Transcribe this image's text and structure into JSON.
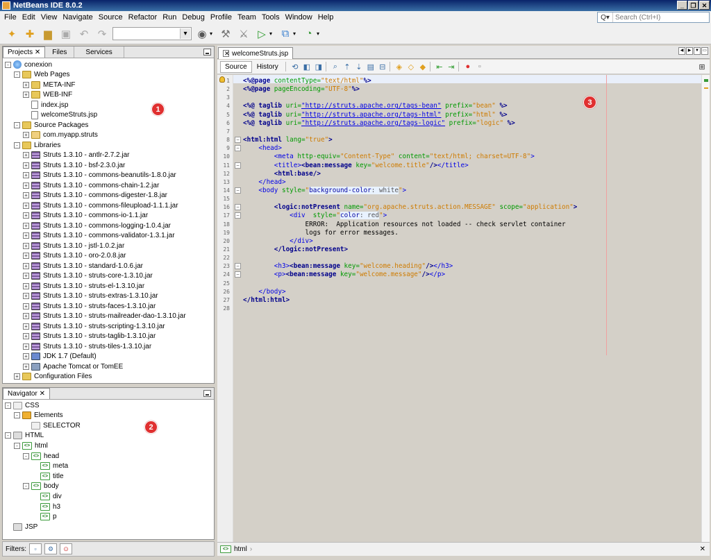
{
  "window": {
    "title": "NetBeans IDE 8.0.2",
    "buttons": [
      "_",
      "❐",
      "✕"
    ]
  },
  "menu": [
    "File",
    "Edit",
    "View",
    "Navigate",
    "Source",
    "Refactor",
    "Run",
    "Debug",
    "Profile",
    "Team",
    "Tools",
    "Window",
    "Help"
  ],
  "search": {
    "placeholder": "Search (Ctrl+I)"
  },
  "projects": {
    "tabs": [
      "Projects ✕",
      "Files",
      "Services"
    ],
    "nodes": [
      {
        "label": "conexion",
        "icon": "globe",
        "depth": 0,
        "exp": "-"
      },
      {
        "label": "Web Pages",
        "icon": "folder",
        "depth": 1,
        "exp": "-"
      },
      {
        "label": "META-INF",
        "icon": "folder",
        "depth": 2,
        "exp": "+"
      },
      {
        "label": "WEB-INF",
        "icon": "folder",
        "depth": 2,
        "exp": "+"
      },
      {
        "label": "index.jsp",
        "icon": "file",
        "depth": 2,
        "exp": ""
      },
      {
        "label": "welcomeStruts.jsp",
        "icon": "file",
        "depth": 2,
        "exp": ""
      },
      {
        "label": "Source Packages",
        "icon": "folder",
        "depth": 1,
        "exp": "-"
      },
      {
        "label": "com.myapp.struts",
        "icon": "pkg",
        "depth": 2,
        "exp": "+"
      },
      {
        "label": "Libraries",
        "icon": "folder",
        "depth": 1,
        "exp": "-"
      },
      {
        "label": "Struts 1.3.10 - antlr-2.7.2.jar",
        "icon": "jar",
        "depth": 2,
        "exp": "+"
      },
      {
        "label": "Struts 1.3.10 - bsf-2.3.0.jar",
        "icon": "jar",
        "depth": 2,
        "exp": "+"
      },
      {
        "label": "Struts 1.3.10 - commons-beanutils-1.8.0.jar",
        "icon": "jar",
        "depth": 2,
        "exp": "+"
      },
      {
        "label": "Struts 1.3.10 - commons-chain-1.2.jar",
        "icon": "jar",
        "depth": 2,
        "exp": "+"
      },
      {
        "label": "Struts 1.3.10 - commons-digester-1.8.jar",
        "icon": "jar",
        "depth": 2,
        "exp": "+"
      },
      {
        "label": "Struts 1.3.10 - commons-fileupload-1.1.1.jar",
        "icon": "jar",
        "depth": 2,
        "exp": "+"
      },
      {
        "label": "Struts 1.3.10 - commons-io-1.1.jar",
        "icon": "jar",
        "depth": 2,
        "exp": "+"
      },
      {
        "label": "Struts 1.3.10 - commons-logging-1.0.4.jar",
        "icon": "jar",
        "depth": 2,
        "exp": "+"
      },
      {
        "label": "Struts 1.3.10 - commons-validator-1.3.1.jar",
        "icon": "jar",
        "depth": 2,
        "exp": "+"
      },
      {
        "label": "Struts 1.3.10 - jstl-1.0.2.jar",
        "icon": "jar",
        "depth": 2,
        "exp": "+"
      },
      {
        "label": "Struts 1.3.10 - oro-2.0.8.jar",
        "icon": "jar",
        "depth": 2,
        "exp": "+"
      },
      {
        "label": "Struts 1.3.10 - standard-1.0.6.jar",
        "icon": "jar",
        "depth": 2,
        "exp": "+"
      },
      {
        "label": "Struts 1.3.10 - struts-core-1.3.10.jar",
        "icon": "jar",
        "depth": 2,
        "exp": "+"
      },
      {
        "label": "Struts 1.3.10 - struts-el-1.3.10.jar",
        "icon": "jar",
        "depth": 2,
        "exp": "+"
      },
      {
        "label": "Struts 1.3.10 - struts-extras-1.3.10.jar",
        "icon": "jar",
        "depth": 2,
        "exp": "+"
      },
      {
        "label": "Struts 1.3.10 - struts-faces-1.3.10.jar",
        "icon": "jar",
        "depth": 2,
        "exp": "+"
      },
      {
        "label": "Struts 1.3.10 - struts-mailreader-dao-1.3.10.jar",
        "icon": "jar",
        "depth": 2,
        "exp": "+"
      },
      {
        "label": "Struts 1.3.10 - struts-scripting-1.3.10.jar",
        "icon": "jar",
        "depth": 2,
        "exp": "+"
      },
      {
        "label": "Struts 1.3.10 - struts-taglib-1.3.10.jar",
        "icon": "jar",
        "depth": 2,
        "exp": "+"
      },
      {
        "label": "Struts 1.3.10 - struts-tiles-1.3.10.jar",
        "icon": "jar",
        "depth": 2,
        "exp": "+"
      },
      {
        "label": "JDK 1.7 (Default)",
        "icon": "jdk",
        "depth": 2,
        "exp": "+"
      },
      {
        "label": "Apache Tomcat or TomEE",
        "icon": "server",
        "depth": 2,
        "exp": "+"
      },
      {
        "label": "Configuration Files",
        "icon": "folder",
        "depth": 1,
        "exp": "+"
      }
    ]
  },
  "navigator": {
    "tab": "Navigator ✕",
    "nodes": [
      {
        "label": "CSS",
        "icon": "css",
        "depth": 0,
        "exp": "-"
      },
      {
        "label": "Elements",
        "icon": "elem",
        "depth": 1,
        "exp": "-"
      },
      {
        "label": "SELECTOR",
        "icon": "css",
        "depth": 2,
        "exp": ""
      },
      {
        "label": "HTML",
        "icon": "html",
        "depth": 0,
        "exp": "-"
      },
      {
        "label": "html",
        "icon": "tag",
        "depth": 1,
        "exp": "-"
      },
      {
        "label": "head",
        "icon": "tag",
        "depth": 2,
        "exp": "-"
      },
      {
        "label": "meta",
        "icon": "tag",
        "depth": 3,
        "exp": ""
      },
      {
        "label": "title",
        "icon": "tag",
        "depth": 3,
        "exp": ""
      },
      {
        "label": "body",
        "icon": "tag",
        "depth": 2,
        "exp": "-"
      },
      {
        "label": "div",
        "icon": "tag",
        "depth": 3,
        "exp": ""
      },
      {
        "label": "h3",
        "icon": "tag",
        "depth": 3,
        "exp": ""
      },
      {
        "label": "p",
        "icon": "tag",
        "depth": 3,
        "exp": ""
      },
      {
        "label": "JSP",
        "icon": "html",
        "depth": 0,
        "exp": ""
      }
    ],
    "filters_label": "Filters:"
  },
  "editor": {
    "tab": "welcomeStruts.jsp",
    "source_tab": "Source",
    "history_tab": "History",
    "lines": [
      [
        [
          "k",
          "<%@page "
        ],
        [
          "a",
          "contentType="
        ],
        [
          "s",
          "\"text/html\""
        ],
        [
          "k",
          "%>"
        ]
      ],
      [
        [
          "k",
          "<%@page "
        ],
        [
          "a",
          "pageEncoding="
        ],
        [
          "s",
          "\"UTF-8\""
        ],
        [
          "k",
          "%>"
        ]
      ],
      [],
      [
        [
          "k",
          "<%@ taglib "
        ],
        [
          "a",
          "uri="
        ],
        [
          "u",
          "\"http://struts.apache.org/tags-bean\""
        ],
        [
          "a",
          " prefix="
        ],
        [
          "s",
          "\"bean\""
        ],
        [
          "k",
          " %>"
        ]
      ],
      [
        [
          "k",
          "<%@ taglib "
        ],
        [
          "a",
          "uri="
        ],
        [
          "u",
          "\"http://struts.apache.org/tags-html\""
        ],
        [
          "a",
          " prefix="
        ],
        [
          "s",
          "\"html\""
        ],
        [
          "k",
          " %>"
        ]
      ],
      [
        [
          "k",
          "<%@ taglib "
        ],
        [
          "a",
          "uri="
        ],
        [
          "u",
          "\"http://struts.apache.org/tags-logic\""
        ],
        [
          "a",
          " prefix="
        ],
        [
          "s",
          "\"logic\""
        ],
        [
          "k",
          " %>"
        ]
      ],
      [],
      [
        [
          "k",
          "<html:html "
        ],
        [
          "a",
          "lang="
        ],
        [
          "s",
          "\"true\""
        ],
        [
          "k",
          ">"
        ]
      ],
      [
        [
          "b",
          "    "
        ],
        [
          "t",
          "<head>"
        ]
      ],
      [
        [
          "b",
          "        "
        ],
        [
          "t",
          "<meta "
        ],
        [
          "a",
          "http-equiv="
        ],
        [
          "s",
          "\"Content-Type\""
        ],
        [
          "a",
          " content="
        ],
        [
          "s",
          "\"text/html; charset=UTF-8\""
        ],
        [
          "t",
          ">"
        ]
      ],
      [
        [
          "b",
          "        "
        ],
        [
          "t",
          "<title>"
        ],
        [
          "k",
          "<bean:message "
        ],
        [
          "a",
          "key="
        ],
        [
          "s",
          "\"welcome.title\""
        ],
        [
          "k",
          "/>"
        ],
        [
          "t",
          "</title>"
        ]
      ],
      [
        [
          "b",
          "        "
        ],
        [
          "k",
          "<html:base/>"
        ]
      ],
      [
        [
          "b",
          "    "
        ],
        [
          "t",
          "</head>"
        ]
      ],
      [
        [
          "b",
          "    "
        ],
        [
          "t",
          "<body "
        ],
        [
          "a",
          "style="
        ],
        [
          "s",
          "\""
        ],
        [
          "cs",
          "background-color"
        ],
        [
          "cv",
          ": white"
        ],
        [
          "s",
          "\""
        ],
        [
          "t",
          ">"
        ]
      ],
      [],
      [
        [
          "b",
          "        "
        ],
        [
          "k",
          "<logic:notPresent "
        ],
        [
          "a",
          "name="
        ],
        [
          "s",
          "\"org.apache.struts.action.MESSAGE\""
        ],
        [
          "a",
          " scope="
        ],
        [
          "s",
          "\"application\""
        ],
        [
          "k",
          ">"
        ]
      ],
      [
        [
          "b",
          "            "
        ],
        [
          "t",
          "<div  "
        ],
        [
          "a",
          "style="
        ],
        [
          "s",
          "\""
        ],
        [
          "cs",
          "color"
        ],
        [
          "cv",
          ": red"
        ],
        [
          "s",
          "\""
        ],
        [
          "t",
          ">"
        ]
      ],
      [
        [
          "b",
          "                ERROR:  Application resources not loaded -- check servlet container"
        ]
      ],
      [
        [
          "b",
          "                logs for error messages."
        ]
      ],
      [
        [
          "b",
          "            "
        ],
        [
          "t",
          "</div>"
        ]
      ],
      [
        [
          "b",
          "        "
        ],
        [
          "k",
          "</logic:notPresent>"
        ]
      ],
      [],
      [
        [
          "b",
          "        "
        ],
        [
          "t",
          "<h3>"
        ],
        [
          "k",
          "<bean:message "
        ],
        [
          "a",
          "key="
        ],
        [
          "s",
          "\"welcome.heading\""
        ],
        [
          "k",
          "/>"
        ],
        [
          "t",
          "</h3>"
        ]
      ],
      [
        [
          "b",
          "        "
        ],
        [
          "t",
          "<p>"
        ],
        [
          "k",
          "<bean:message "
        ],
        [
          "a",
          "key="
        ],
        [
          "s",
          "\"welcome.message\""
        ],
        [
          "k",
          "/>"
        ],
        [
          "t",
          "</p>"
        ]
      ],
      [],
      [
        [
          "b",
          "    "
        ],
        [
          "t",
          "</body>"
        ]
      ],
      [
        [
          "k",
          "</html:html>"
        ]
      ],
      []
    ]
  },
  "breadcrumb": "html",
  "badges": [
    "1",
    "2",
    "3"
  ]
}
